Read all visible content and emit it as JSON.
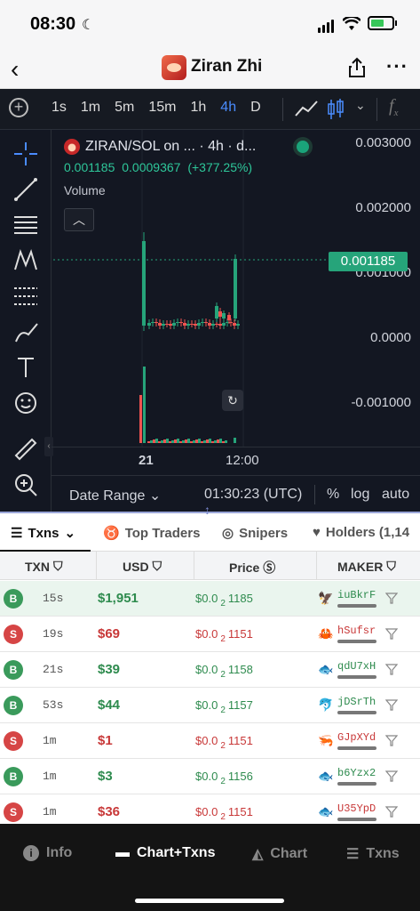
{
  "status_bar": {
    "time": "08:30"
  },
  "nav": {
    "title": "Ziran Zhi"
  },
  "toolbar": {
    "intervals": [
      "1s",
      "1m",
      "5m",
      "15m",
      "1h",
      "4h",
      "D"
    ],
    "active_interval": "4h",
    "fx_label": "f",
    "fx_sub": "x"
  },
  "chart": {
    "legend_title": "ZIRAN/SOL on ... · 4h · d...",
    "legend_price": "0.001185",
    "legend_prev": "0.0009367",
    "legend_change": "(+377.25%)",
    "volume_label": "Volume",
    "y_labels": [
      "0.003000",
      "0.002000",
      "0.001000",
      "0.0000",
      "-0.001000"
    ],
    "current_price": "0.001185",
    "x_labels": [
      "21",
      "12:00"
    ],
    "date_range": "Date Range",
    "time_utc": "01:30:23 (UTC)",
    "percent": "%",
    "log": "log",
    "auto": "auto",
    "accent_up": "#26a47a",
    "accent_down": "#ef5350"
  },
  "tabs": [
    {
      "label": "Txns"
    },
    {
      "label": "Top Traders"
    },
    {
      "label": "Snipers"
    },
    {
      "label": "Holders (1,14"
    }
  ],
  "table": {
    "headers": {
      "txn": "TXN",
      "usd": "USD",
      "price": "Price",
      "maker": "MAKER"
    },
    "rows": [
      {
        "side": "B",
        "age": "15s",
        "usd": "$1,951",
        "price_pre": "$0.0",
        "price_sub": "2",
        "price_post": "1185",
        "maker": "iuBkrF",
        "icon": "🦅",
        "type": "buy"
      },
      {
        "side": "S",
        "age": "19s",
        "usd": "$69",
        "price_pre": "$0.0",
        "price_sub": "2",
        "price_post": "1151",
        "maker": "hSufsr",
        "icon": "🦀",
        "type": "sell"
      },
      {
        "side": "B",
        "age": "21s",
        "usd": "$39",
        "price_pre": "$0.0",
        "price_sub": "2",
        "price_post": "1158",
        "maker": "qdU7xH",
        "icon": "🐟",
        "type": "buy"
      },
      {
        "side": "B",
        "age": "53s",
        "usd": "$44",
        "price_pre": "$0.0",
        "price_sub": "2",
        "price_post": "1157",
        "maker": "jDSrTh",
        "icon": "🐬",
        "type": "buy"
      },
      {
        "side": "S",
        "age": "1m",
        "usd": "$1",
        "price_pre": "$0.0",
        "price_sub": "2",
        "price_post": "1151",
        "maker": "GJpXYd",
        "icon": "🦐",
        "type": "sell"
      },
      {
        "side": "B",
        "age": "1m",
        "usd": "$3",
        "price_pre": "$0.0",
        "price_sub": "2",
        "price_post": "1156",
        "maker": "b6Yzx2",
        "icon": "🐟",
        "type": "buy"
      },
      {
        "side": "S",
        "age": "1m",
        "usd": "$36",
        "price_pre": "$0.0",
        "price_sub": "2",
        "price_post": "1151",
        "maker": "U35YpD",
        "icon": "🐟",
        "type": "sell"
      }
    ]
  },
  "bottom_nav": [
    {
      "label": "Info"
    },
    {
      "label": "Chart+Txns"
    },
    {
      "label": "Chart"
    },
    {
      "label": "Txns"
    }
  ]
}
